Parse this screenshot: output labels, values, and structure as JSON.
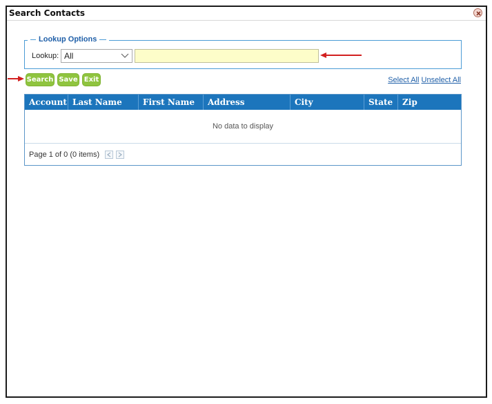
{
  "dialog": {
    "title": "Search Contacts",
    "close_icon": "close-icon"
  },
  "lookup": {
    "legend": "Lookup Options",
    "label": "Lookup:",
    "selected": "All",
    "input_value": ""
  },
  "toolbar": {
    "search": "Search",
    "save": "Save",
    "exit": "Exit",
    "select_all": "Select All",
    "unselect_all": "Unselect All"
  },
  "grid": {
    "columns": [
      "Account",
      "Last Name",
      "First Name",
      "Address",
      "City",
      "State",
      "Zip"
    ],
    "empty_text": "No data to display",
    "pager_text": "Page 1 of 0 (0 items)"
  },
  "colors": {
    "header": "#1c75bc",
    "button": "#8fc43f",
    "input_bg": "#fdfdc9",
    "annotation_arrow": "#d21f1f"
  }
}
